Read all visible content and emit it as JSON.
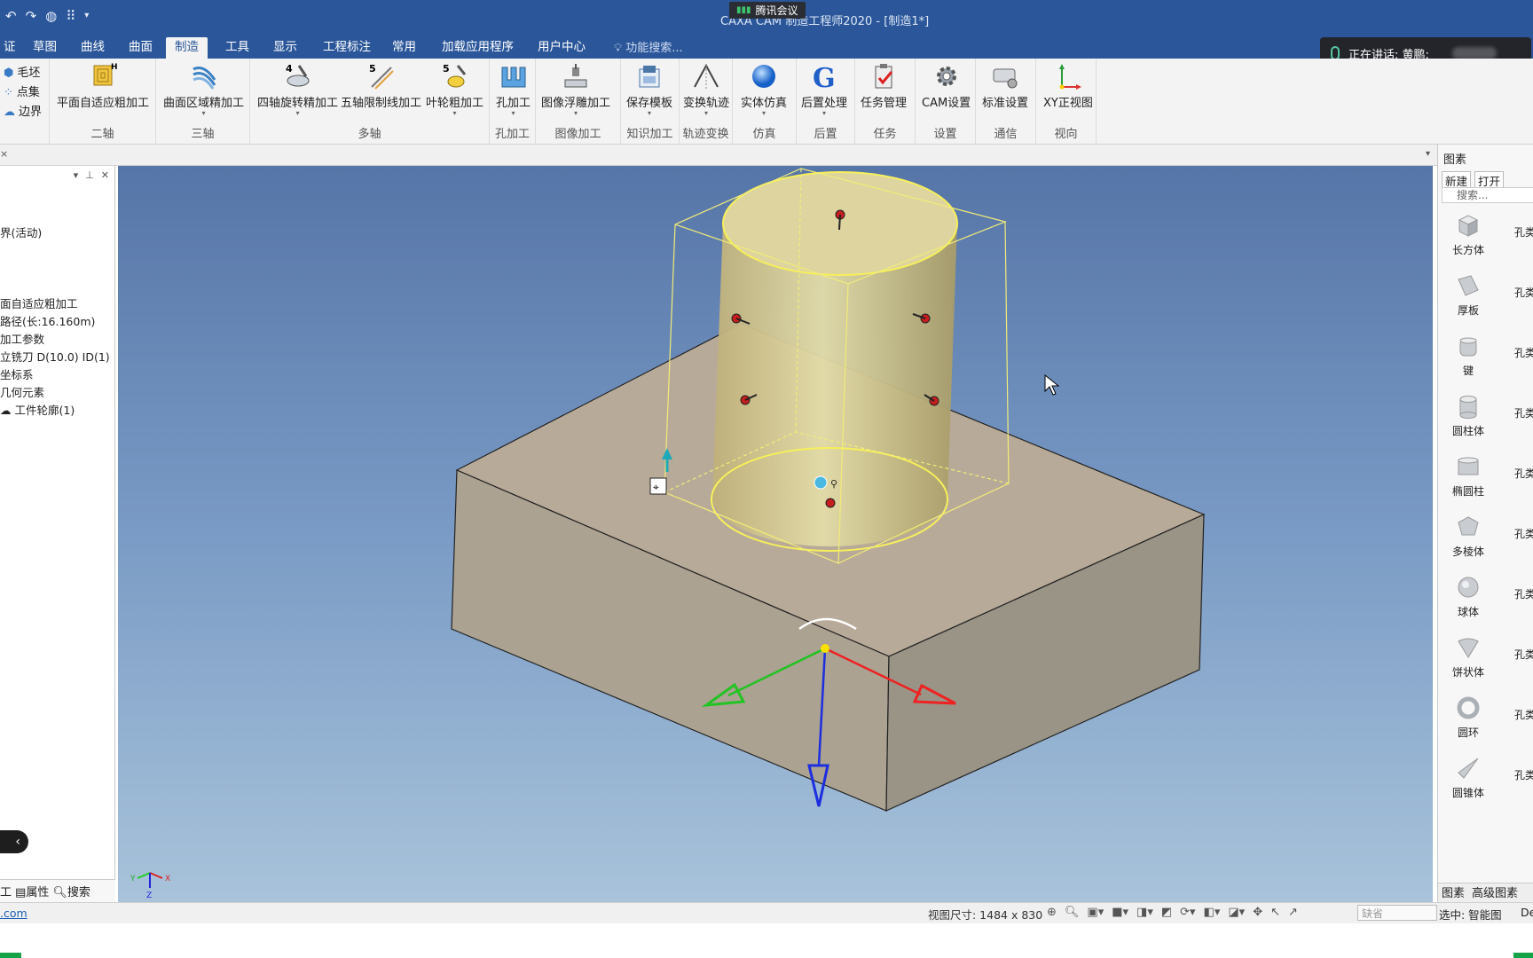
{
  "titlebar": {
    "window_title": "CAXA CAM 制造工程师2020 - [制造1*]",
    "meeting_badge": "腾讯会议"
  },
  "menu": {
    "tabs": [
      "证",
      "草图",
      "曲线",
      "曲面",
      "制造",
      "工具",
      "显示",
      "工程标注",
      "常用",
      "加载应用程序",
      "用户中心"
    ],
    "active_tab": "制造",
    "search_placeholder": "功能搜索..."
  },
  "speaking": {
    "label": "正在讲话: 黄鹏;"
  },
  "ribbon": {
    "small_items": [
      "毛坯",
      "点集",
      "边界"
    ],
    "groups": {
      "two_axis": {
        "label": "二轴",
        "btn": "平面自适应粗加工"
      },
      "three_axis": {
        "label": "三轴",
        "btn": "曲面区域精加工"
      },
      "multi_axis": {
        "label": "多轴",
        "btn1": "四轴旋转精加工",
        "btn2": "五轴限制线加工",
        "btn3": "叶轮粗加工"
      },
      "hole": {
        "label": "孔加工",
        "btn": "孔加工"
      },
      "image": {
        "label": "图像加工",
        "btn": "图像浮雕加工"
      },
      "knowledge": {
        "label": "知识加工",
        "btn": "保存模板"
      },
      "transform": {
        "label": "轨迹变换",
        "btn": "变换轨迹"
      },
      "sim": {
        "label": "仿真",
        "btn": "实体仿真"
      },
      "post": {
        "label": "后置",
        "btn": "后置处理"
      },
      "task": {
        "label": "任务",
        "btn": "任务管理"
      },
      "settings": {
        "label": "设置",
        "btn": "CAM设置"
      },
      "comm": {
        "label": "通信",
        "btn": "标准设置"
      },
      "view": {
        "label": "视向",
        "btn": "XY正视图"
      }
    }
  },
  "left_panel": {
    "tree": [
      "界(活动)",
      "",
      "",
      "",
      "面自适应粗加工",
      "路径(长:16.160m)",
      "加工参数",
      "立铣刀 D(10.0) ID(1)",
      "坐标系",
      "几何元素",
      "工件轮廓(1)"
    ],
    "tabs": [
      "工",
      "属性",
      "搜索"
    ]
  },
  "right_panel": {
    "title": "图素",
    "new": "新建",
    "open": "打开",
    "search": "搜索...",
    "items": [
      "长方体",
      "厚板",
      "键",
      "圆柱体",
      "椭圆柱",
      "多棱体",
      "球体",
      "饼状体",
      "圆环",
      "圆锥体"
    ],
    "side_label": "孔类",
    "tabs": [
      "图素",
      "高级图素"
    ]
  },
  "status": {
    "link": ".com",
    "view_size": "视图尺寸: 1484 x  830",
    "combo": "缺省",
    "selection": "选中: 智能图",
    "de": "De"
  },
  "colors": {
    "accent": "#2b579a",
    "viewport_top": "#5675a8",
    "viewport_bottom": "#a8c3da",
    "block": "#b9aa98",
    "cylinder": "#d8d098"
  }
}
